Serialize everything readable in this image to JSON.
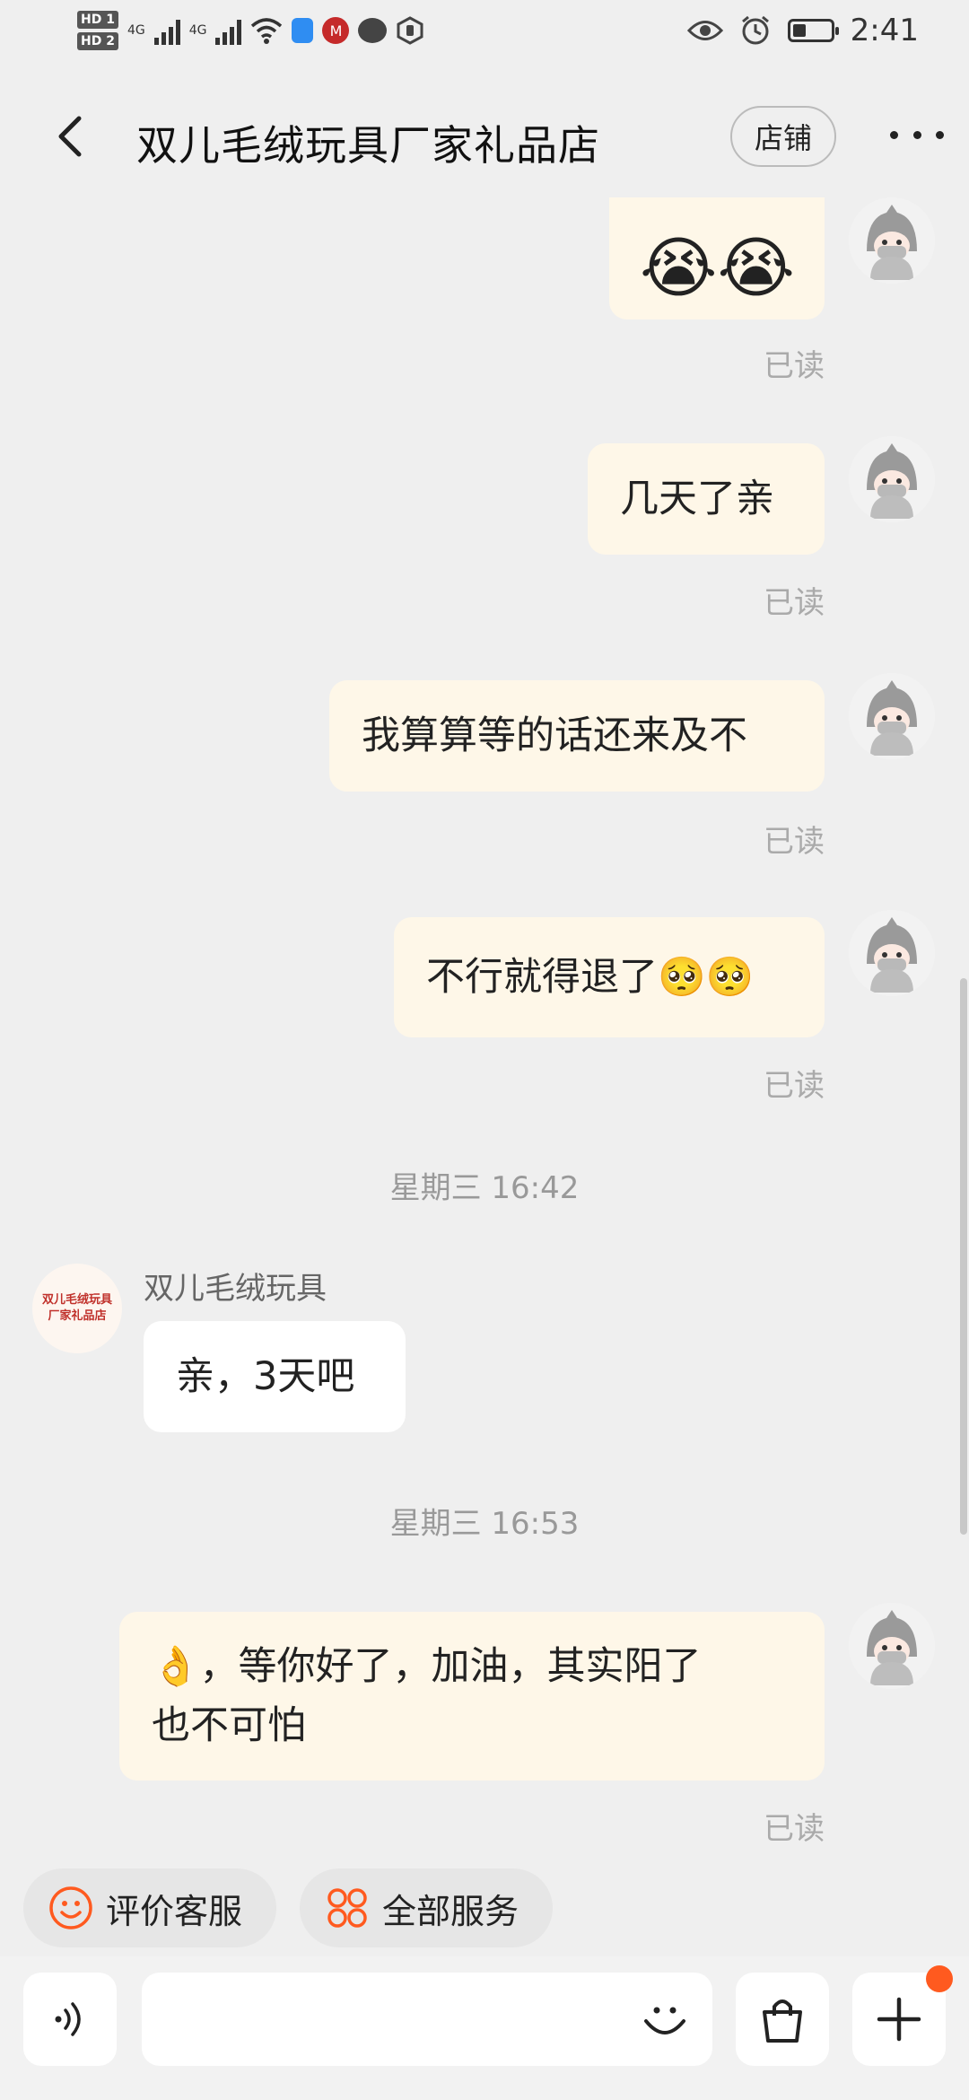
{
  "status_bar": {
    "sim1": "HD 1",
    "sim2": "HD 2",
    "network1": "4G",
    "network2": "4G",
    "time": "2:41",
    "icons": [
      "signal-icon",
      "wifi-icon",
      "shield-icon",
      "app-icon",
      "message-icon",
      "hand-icon",
      "eye-icon",
      "alarm-icon",
      "battery-icon"
    ]
  },
  "header": {
    "title": "双儿毛绒玩具厂家礼品店",
    "shop_button": "店铺",
    "back_icon": "back-arrow-icon",
    "more_icon": "more-dots-icon"
  },
  "messages": {
    "m1": {
      "text": "😭😭",
      "status": "已读"
    },
    "m2": {
      "text": "几天了亲",
      "status": "已读"
    },
    "m3": {
      "text": "我算算等的话还来及不",
      "status": "已读"
    },
    "m4": {
      "text": "不行就得退了🥺🥺",
      "status": "已读"
    },
    "ts1": "星期三 16:42",
    "shop_sender": "双儿毛绒玩具",
    "shop_avatar_text": "双儿毛绒玩具厂家礼品店",
    "m5": {
      "text": "亲，3天吧"
    },
    "ts2": "星期三 16:53",
    "m6": {
      "line1": "👌，等你好了，加油，其实阳了",
      "line2": "也不可怕",
      "status": "已读"
    }
  },
  "quick_actions": {
    "rate": "评价客服",
    "services": "全部服务"
  },
  "input": {
    "placeholder": "",
    "voice_icon": "voice-icon",
    "emoji_icon": "smile-icon",
    "bag_icon": "shopping-bag-icon",
    "plus_icon": "plus-icon"
  },
  "colors": {
    "accent": "#ff5a1f",
    "bubble_out": "#fef7e8",
    "bubble_in": "#ffffff",
    "background": "#efefef"
  }
}
